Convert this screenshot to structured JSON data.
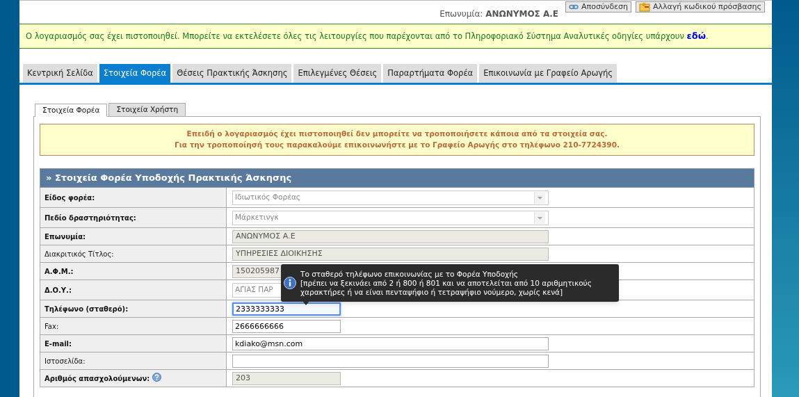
{
  "header": {
    "company_label": "Επωνυμία:",
    "company_name": "ΑΝΩΝΥΜΟΣ Α.Ε",
    "buttons": [
      {
        "label": "Αποσύνδεση",
        "kind": "logout"
      },
      {
        "label": "Αλλαγή κωδικού πρόσβασης",
        "kind": "password"
      }
    ]
  },
  "notice": {
    "text": "Ο λογαριασμός σας έχει πιστοποιηθεί. Μπορείτε να εκτελέσετε όλες τις λειτουργίες που παρέχονται από το Πληροφοριακό Σύστημα Αναλυτικές οδηγίες υπάρχουν",
    "link": "εδώ",
    "end": "."
  },
  "tabs": [
    {
      "label": "Κεντρική Σελίδα",
      "selected": false
    },
    {
      "label": "Στοιχεία Φορέα",
      "selected": true
    },
    {
      "label": "Θέσεις Πρακτικής Άσκησης",
      "selected": false
    },
    {
      "label": "Επιλεγμένες Θέσεις",
      "selected": false
    },
    {
      "label": "Παραρτήματα Φορέα",
      "selected": false
    },
    {
      "label": "Επικοινωνία με Γραφείο Αρωγής",
      "selected": false
    }
  ],
  "sub_tabs": [
    {
      "label": "Στοιχεία Φορέα",
      "selected": true
    },
    {
      "label": "Στοιχεία Χρήστη",
      "selected": false
    }
  ],
  "warning": [
    "Επειδή ο λογαριασμός έχει πιστοποιηθεί δεν μπορείτε να τροποποιήσετε κάποια από τα στοιχεία σας.",
    "Για την τροποποίησή τους παρακαλούμε επικοινωνήστε με το Γραφείο Αρωγής στο τηλέφωνο 210-7724390."
  ],
  "section": {
    "title": "» Στοιχεία Φορέα Υποδοχής Πρακτικής Άσκησης",
    "fields": [
      {
        "label": "Είδος φορέα:",
        "required": true,
        "kind": "select",
        "value": "Ιδιωτικός Φορέας",
        "wide": true
      },
      {
        "label": "Πεδίο δραστηριότητας:",
        "required": true,
        "kind": "select",
        "value": "Μάρκετινγκ",
        "wide": true
      },
      {
        "label": "Επωνυμία:",
        "required": true,
        "kind": "readonly",
        "value": "ΑΝΩΝΥΜΟΣ Α.Ε",
        "wide": true
      },
      {
        "label": "Διακριτικός Τίτλος:",
        "required": false,
        "kind": "readonly",
        "value": "ΥΠΗΡΕΣΙΕΣ ΔΙΟΙΚΗΣΗΣ",
        "wide": true
      },
      {
        "label": "Α.Φ.Μ.:",
        "required": true,
        "kind": "readonly",
        "value": "150205987",
        "wide": false
      },
      {
        "label": "Δ.Ο.Υ.:",
        "required": true,
        "kind": "select",
        "value": "ΑΓΙΑΣ ΠΑΡ",
        "wide": true
      },
      {
        "label": "Τηλέφωνο (σταθερό):",
        "required": true,
        "kind": "text",
        "value": "2333333333",
        "wide": false,
        "focused": true,
        "tooltip": [
          "Το σταθερό τηλέφωνο επικοινωνίας με το Φορέα Υποδοχής",
          "[πρέπει να ξεκινάει από 2 ή 800 ή 801 και να αποτελείται από 10 αριθμητικούς χαρακτήρες ή να είναι πενταψήφιο ή τετραψήφιο νούμερο, χωρίς κενά]"
        ]
      },
      {
        "label": "Fax:",
        "required": false,
        "kind": "text",
        "value": "2666666666",
        "wide": false,
        "focused": false
      },
      {
        "label": "E-mail:",
        "required": true,
        "kind": "text",
        "value": "kdiako@msn.com",
        "wide": true,
        "focused": false
      },
      {
        "label": "Ιστοσελίδα:",
        "required": false,
        "kind": "text",
        "wide": true,
        "focused": false
      },
      {
        "label": "Αριθμός απασχολούμενων:",
        "required": true,
        "kind": "readonly",
        "value": "203",
        "wide": false,
        "help": true
      }
    ]
  }
}
